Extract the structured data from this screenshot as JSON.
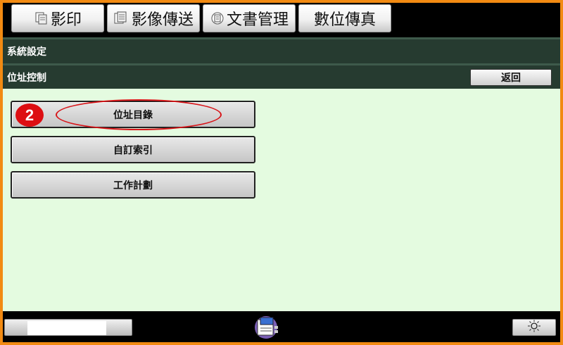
{
  "tabs": [
    {
      "label": "影印",
      "icon": "copy-icon"
    },
    {
      "label": "影像傳送",
      "icon": "image-send-icon"
    },
    {
      "label": "文書管理",
      "icon": "document-filing-icon"
    },
    {
      "label": "數位傳真",
      "icon": ""
    }
  ],
  "header": {
    "title": "系統設定",
    "subtitle": "位址控制",
    "back_label": "返回"
  },
  "menu": {
    "items": [
      {
        "label": "位址目錄"
      },
      {
        "label": "自訂索引"
      },
      {
        "label": "工作計劃"
      }
    ]
  },
  "callout": {
    "number": "2",
    "color": "#dd0e12"
  },
  "colors": {
    "frame": "#f28a12",
    "header_bar": "#263b30",
    "content_bg": "#e4fbe0"
  },
  "footer": {
    "job_status_icon": "job-status-icon",
    "brightness_icon": "brightness-icon"
  }
}
